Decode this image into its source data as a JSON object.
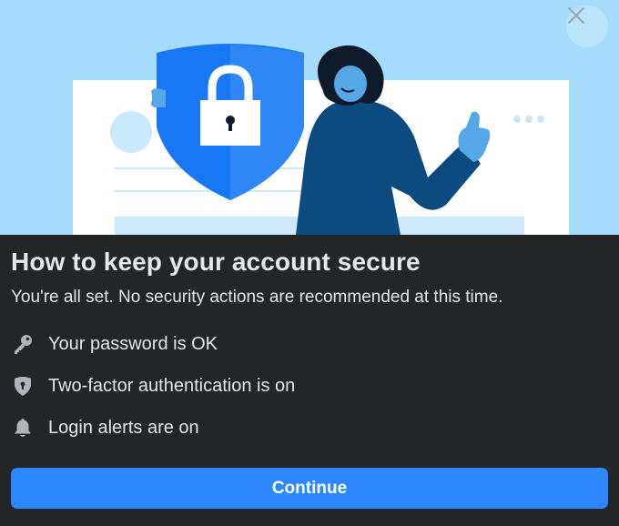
{
  "dialog": {
    "title": "How to keep your account secure",
    "subtitle": "You're all set. No security actions are recommended at this time.",
    "close_icon": "close-icon",
    "items": [
      {
        "icon": "key-icon",
        "label": "Your password is OK"
      },
      {
        "icon": "shield-icon",
        "label": "Two-factor authentication is on"
      },
      {
        "icon": "bell-icon",
        "label": "Login alerts are on"
      }
    ],
    "continue_label": "Continue"
  },
  "colors": {
    "hero_background": "#a6dcfb",
    "panel_background": "#242526",
    "primary_button": "#2d88ff",
    "text_primary": "#e4e6eb",
    "icon_gray": "#b0b3b8",
    "shield_blue": "#1877f2"
  }
}
